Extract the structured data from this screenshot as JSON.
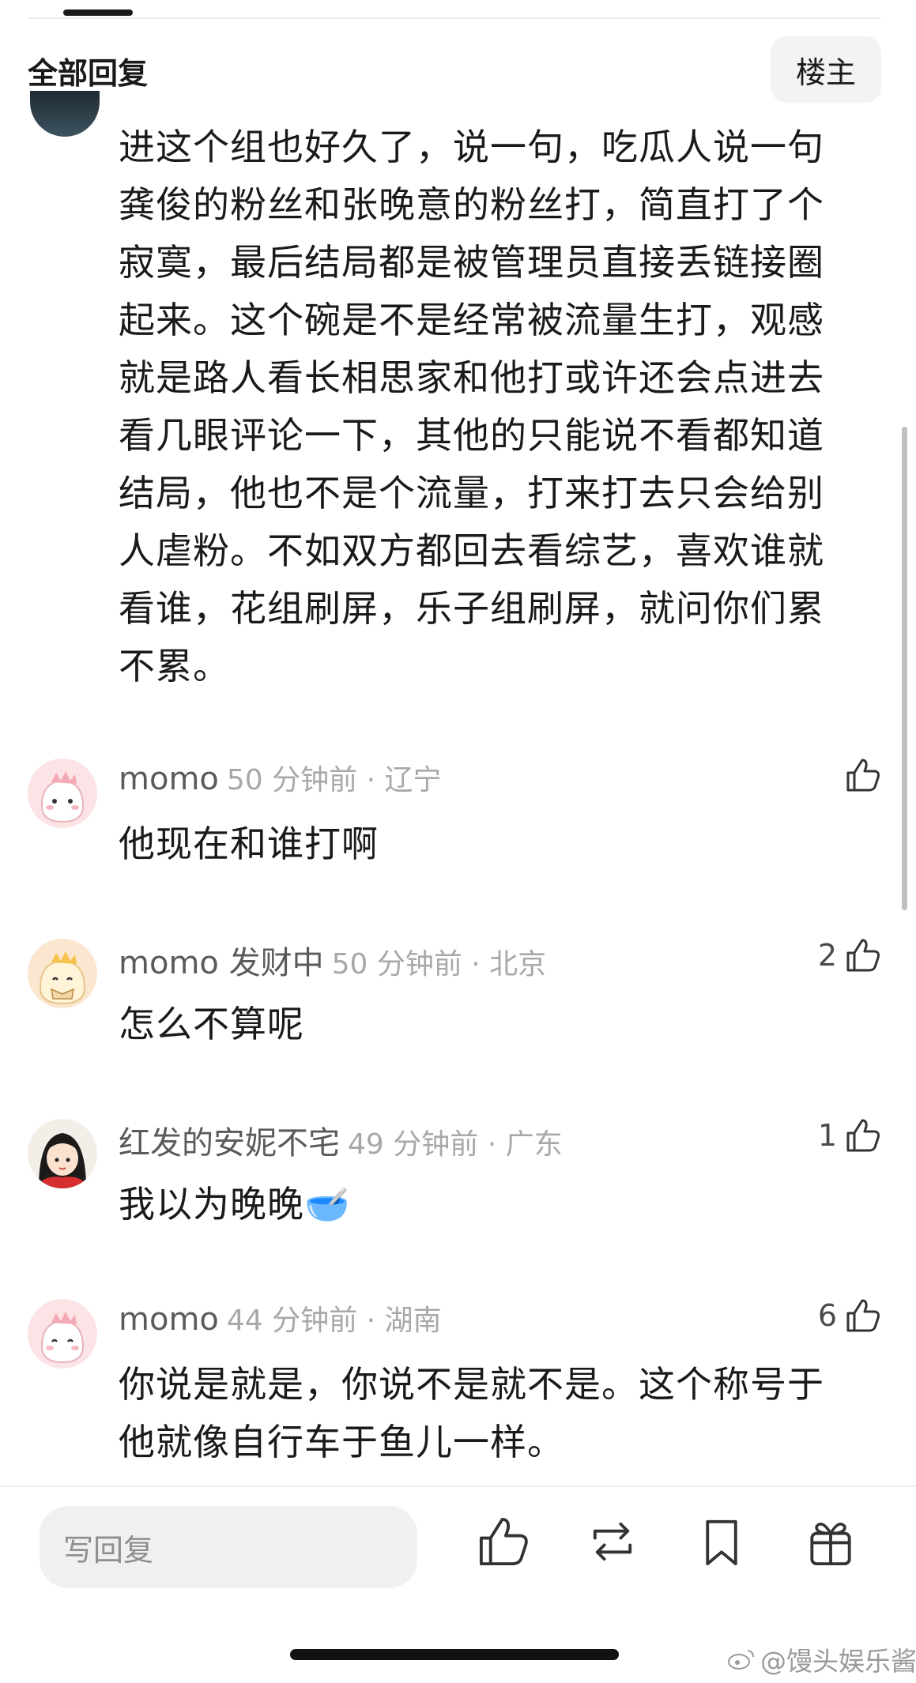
{
  "header": {
    "title": "全部回复",
    "owner_button": "楼主"
  },
  "main_comment": {
    "text": "进这个组也好久了，说一句，吃瓜人说一句龚俊的粉丝和张晚意的粉丝打，简直打了个寂寞，最后结局都是被管理员直接丢链接圈起来。这个碗是不是经常被流量生打，观感就是路人看长相思家和他打或许还会点进去看几眼评论一下，其他的只能说不看都知道结局，他也不是个流量，打来打去只会给别人虐粉。不如双方都回去看综艺，喜欢谁就看谁，花组刷屏，乐子组刷屏，就问你们累不累。"
  },
  "replies": [
    {
      "name": "momo",
      "meta": "50 分钟前 · 辽宁",
      "text": "他现在和谁打啊",
      "likes": ""
    },
    {
      "name": "momo 发财中",
      "meta": "50 分钟前 · 北京",
      "text": "怎么不算呢",
      "likes": "2"
    },
    {
      "name": "红发的安妮不宅",
      "meta": "49 分钟前 · 广东",
      "text": "我以为晚晚🥣",
      "likes": "1"
    },
    {
      "name": "momo",
      "meta": "44 分钟前 · 湖南",
      "text": "你说是就是，你说不是就不是。这个称号于他就像自行车于鱼儿一样。",
      "likes": "6"
    }
  ],
  "bottom_bar": {
    "reply_placeholder": "写回复",
    "icons": [
      "thumbs-up-icon",
      "repost-icon",
      "bookmark-icon",
      "gift-icon"
    ]
  },
  "watermark": "@馒头娱乐酱",
  "colors": {
    "text": "#1a1a1a",
    "name": "#5a5a5a",
    "meta": "#a8a8a8",
    "input_bg": "#eef1ef"
  }
}
